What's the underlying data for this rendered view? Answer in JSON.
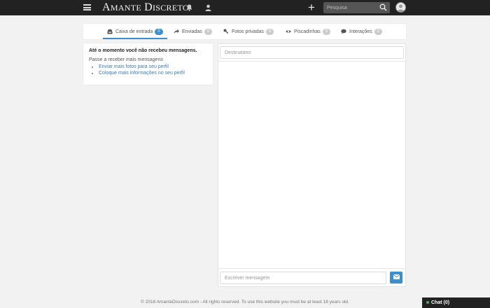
{
  "header": {
    "logo_first": "A",
    "logo_rest": "MANTE",
    "logo_second_first": "D",
    "logo_second_rest": "ISCRETO",
    "search_placeholder": "Pesquisa",
    "icons": [
      "menu-icon",
      "bell-icon",
      "user-icon",
      "plus-icon",
      "search-icon",
      "avatar"
    ]
  },
  "tabs": [
    {
      "label": "Caixa de entrada",
      "count": "0",
      "icon": "inbox-icon",
      "active": true
    },
    {
      "label": "Enviadas",
      "count": "0",
      "icon": "reply-icon",
      "active": false
    },
    {
      "label": "Fotos privadas",
      "count": "0",
      "icon": "key-icon",
      "active": false
    },
    {
      "label": "Piscadinhas",
      "count": "0",
      "icon": "eye-icon",
      "active": false
    },
    {
      "label": "Interações",
      "count": "0",
      "icon": "chat-bubble-icon",
      "active": false
    }
  ],
  "left_panel": {
    "title": "Até o momento você não recebeu mensagens.",
    "subtitle": "Passe a receber mais mensagens",
    "links": [
      "Enviar mais fotos para seu perfil",
      "Coloque mais informações no seu perfil"
    ]
  },
  "compose": {
    "recipient_placeholder": "Destinatário",
    "message_placeholder": "Escrever mensagem"
  },
  "footer": {
    "text": "© 2018 AmanteDiscreto.com - All rights reserved. To use this website you must be at least 18 years old."
  },
  "chat": {
    "label": "Chat (0)"
  },
  "colors": {
    "accent": "#3a8fd1",
    "topbar": "#222222",
    "background": "#f2f2f2",
    "link": "#3a7bbf"
  }
}
